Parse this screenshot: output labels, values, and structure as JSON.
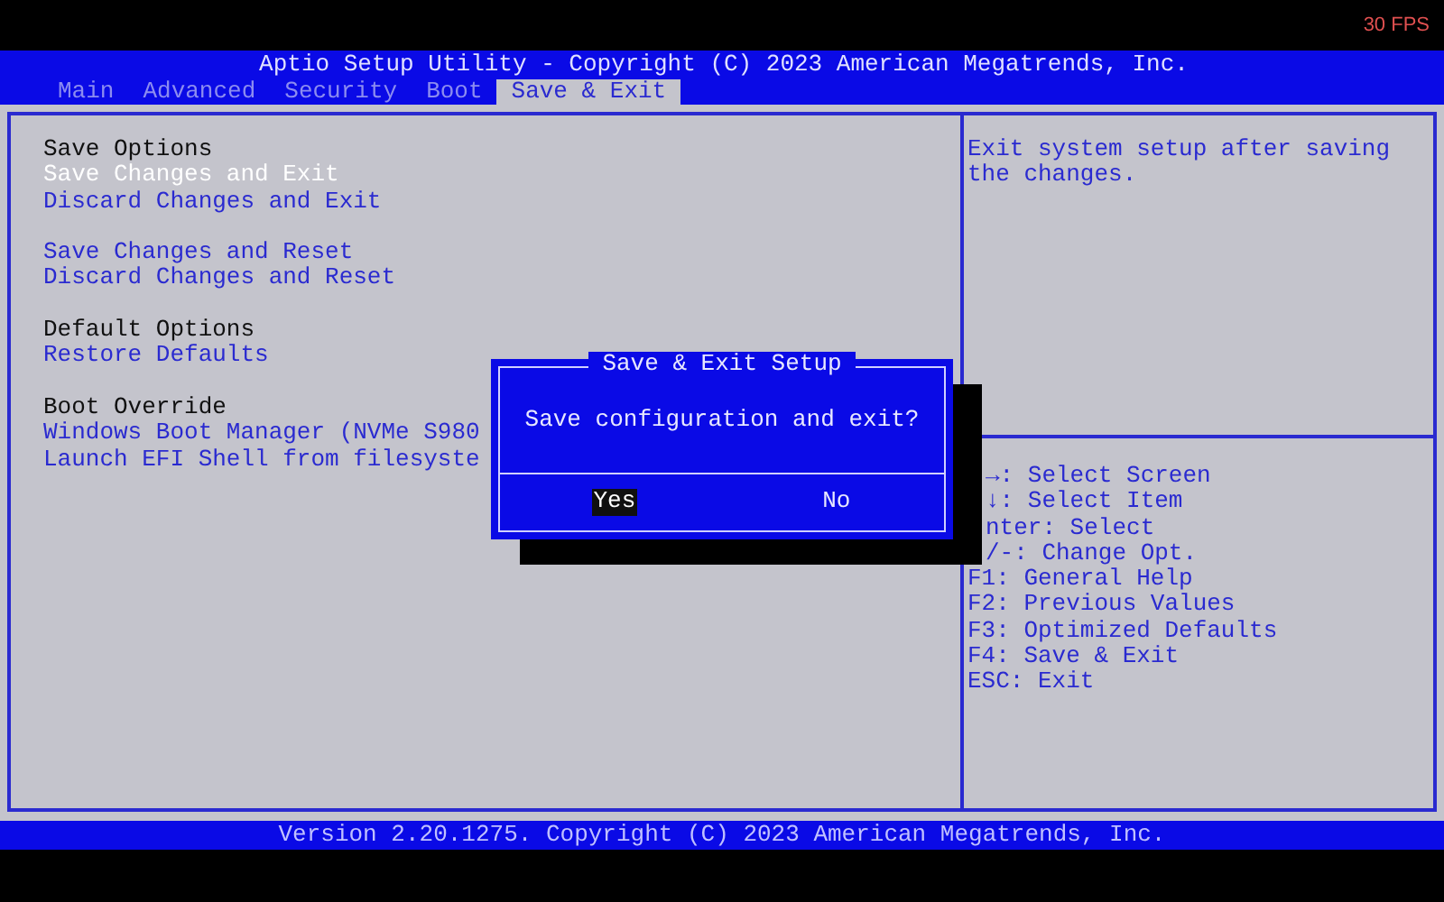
{
  "overlay": {
    "fps": "30 FPS"
  },
  "title_bar": {
    "title": "Aptio Setup Utility - Copyright (C) 2023 American Megatrends, Inc."
  },
  "tabs": [
    {
      "label": "Main",
      "selected": false
    },
    {
      "label": "Advanced",
      "selected": false
    },
    {
      "label": "Security",
      "selected": false
    },
    {
      "label": "Boot",
      "selected": false
    },
    {
      "label": "Save & Exit",
      "selected": true
    }
  ],
  "menu": [
    {
      "heading": "Save Options",
      "items": [
        {
          "label": "Save Changes and Exit",
          "selected": true
        },
        {
          "label": "Discard Changes and Exit",
          "selected": false
        }
      ]
    },
    {
      "items": [
        {
          "label": "Save Changes and Reset",
          "selected": false
        },
        {
          "label": "Discard Changes and Reset",
          "selected": false
        }
      ]
    },
    {
      "heading": "Default Options",
      "items": [
        {
          "label": "Restore Defaults",
          "selected": false
        }
      ]
    },
    {
      "heading": "Boot Override",
      "items": [
        {
          "label": "Windows Boot Manager (NVMe S980",
          "selected": false
        },
        {
          "label": "Launch EFI Shell from filesyste",
          "selected": false
        }
      ]
    }
  ],
  "help_text": "Exit system setup after saving the changes.",
  "key_help": [
    {
      "text": "→: Select Screen",
      "kind": "partial"
    },
    {
      "text": "↓: Select Item",
      "kind": "partial"
    },
    {
      "text": "nter: Select",
      "kind": "partial"
    },
    {
      "text": "/-: Change Opt.",
      "kind": "partial"
    },
    {
      "text": "F1: General Help",
      "kind": "full"
    },
    {
      "text": "F2: Previous Values",
      "kind": "full"
    },
    {
      "text": "F3: Optimized Defaults",
      "kind": "full"
    },
    {
      "text": "F4: Save & Exit",
      "kind": "full"
    },
    {
      "text": "ESC: Exit",
      "kind": "full"
    }
  ],
  "dialog": {
    "title": "Save & Exit Setup",
    "message": "Save configuration and exit?",
    "buttons": [
      {
        "label": "Yes",
        "selected": true
      },
      {
        "label": "No",
        "selected": false
      }
    ]
  },
  "footer": {
    "text": "Version 2.20.1275. Copyright (C) 2023 American Megatrends, Inc."
  }
}
